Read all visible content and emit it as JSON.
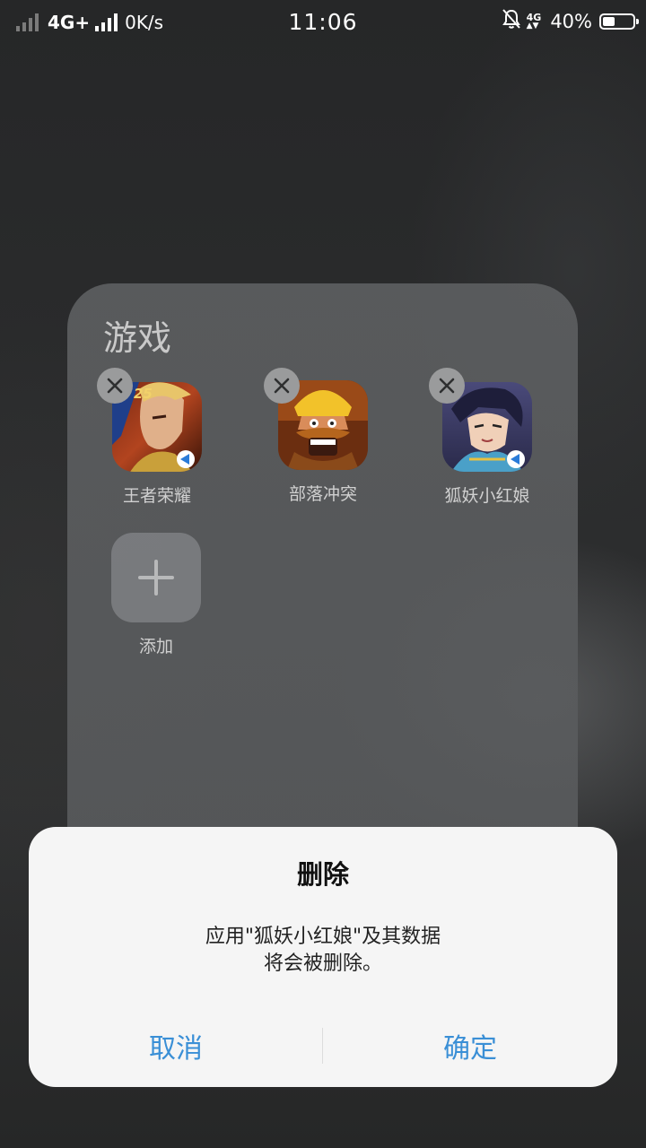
{
  "status_bar": {
    "network_primary": "4G+",
    "speed": "0K/s",
    "time": "11:06",
    "network_secondary": "4G",
    "battery_percent": "40%",
    "battery_level": 0.4
  },
  "folder": {
    "title": "游戏",
    "apps": [
      {
        "label": "王者荣耀",
        "icon": "honor-of-kings-icon",
        "removable": true
      },
      {
        "label": "部落冲突",
        "icon": "clash-of-clans-icon",
        "removable": true
      },
      {
        "label": "狐妖小红娘",
        "icon": "fox-spirit-matchmaker-icon",
        "removable": true
      }
    ],
    "add_label": "添加"
  },
  "dialog": {
    "title": "删除",
    "message_line1": "应用\"狐妖小红娘\"及其数据",
    "message_line2": "将会被删除。",
    "cancel_label": "取消",
    "confirm_label": "确定",
    "accent_color": "#3a8fd6"
  }
}
